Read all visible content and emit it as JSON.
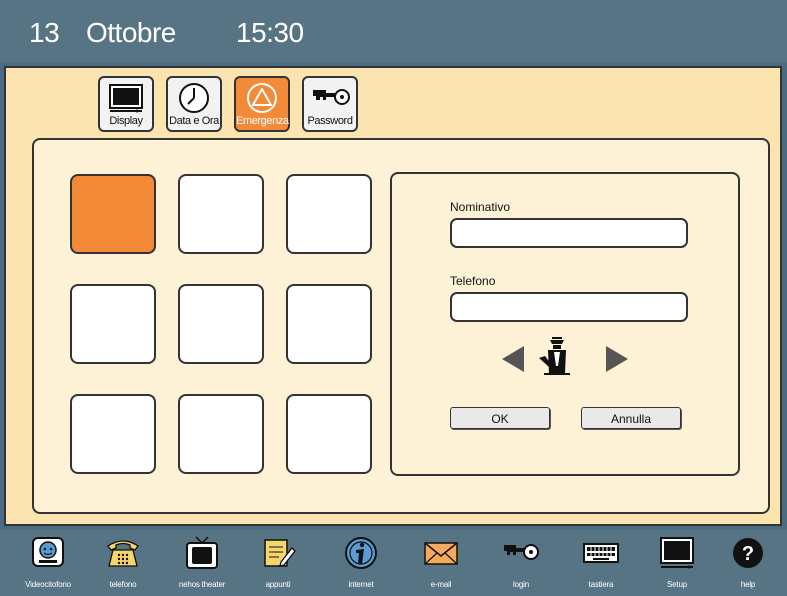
{
  "header": {
    "day": "13",
    "month": "Ottobre",
    "time": "15:30"
  },
  "tabs": [
    {
      "label": "Display",
      "icon": "monitor-icon",
      "active": false
    },
    {
      "label": "Data e Ora",
      "icon": "clock-icon",
      "active": false
    },
    {
      "label": "Emergenza",
      "icon": "warning-triangle-icon",
      "active": true
    },
    {
      "label": "Password",
      "icon": "key-icon",
      "active": false
    }
  ],
  "grid": {
    "rows": 3,
    "cols": 3,
    "selected_index": 0
  },
  "form": {
    "name_label": "Nominativo",
    "name_value": "",
    "phone_label": "Telefono",
    "phone_value": "",
    "ok_label": "OK",
    "cancel_label": "Annulla"
  },
  "bottom_bar": [
    {
      "label": "Videocitofono",
      "icon": "videophone-icon"
    },
    {
      "label": "telefono",
      "icon": "telephone-icon"
    },
    {
      "label": "nehos theater",
      "icon": "tv-icon"
    },
    {
      "label": "appunti",
      "icon": "notepad-icon"
    },
    {
      "label": "internet",
      "icon": "internet-icon"
    },
    {
      "label": "e-mail",
      "icon": "envelope-icon"
    },
    {
      "label": "login",
      "icon": "key-icon"
    },
    {
      "label": "tastiera",
      "icon": "keyboard-icon"
    },
    {
      "label": "Setup",
      "icon": "monitor-icon"
    },
    {
      "label": "help",
      "icon": "help-icon"
    }
  ],
  "colors": {
    "accent": "#f28a38",
    "bar": "#577484",
    "background": "#fbe4b0"
  }
}
